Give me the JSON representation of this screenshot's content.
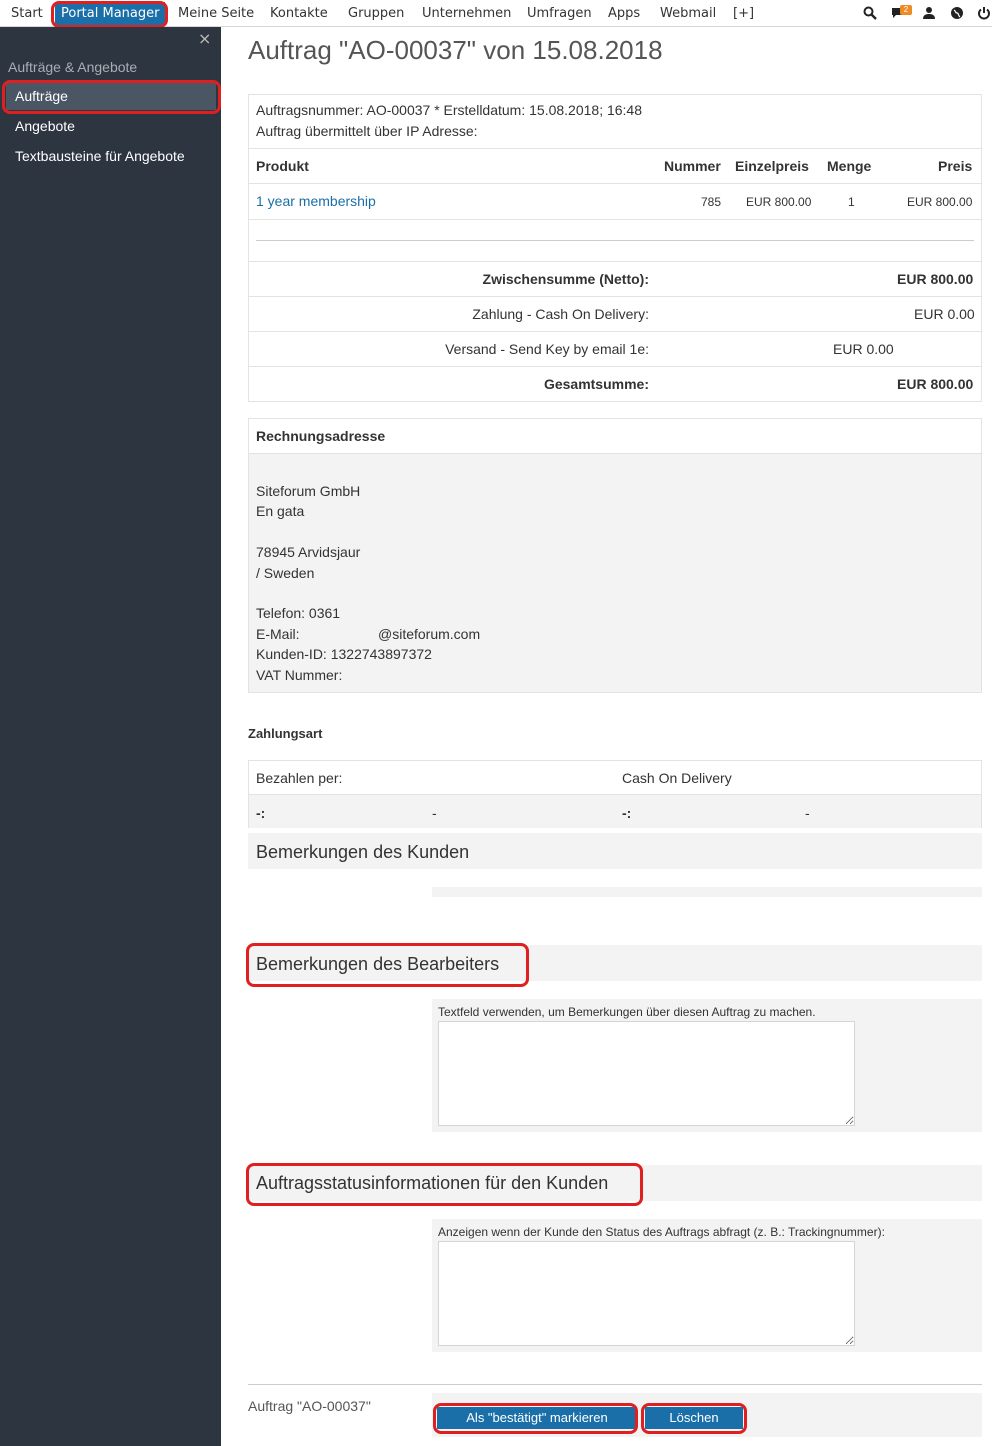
{
  "topnav": {
    "items": [
      "Start",
      "Portal Manager",
      "Meine Seite",
      "Kontakte",
      "Gruppen",
      "Unternehmen",
      "Umfragen",
      "Apps",
      "Webmail",
      "[+]"
    ],
    "badge_count": "2",
    "icons": [
      "search-icon",
      "chat-icon",
      "user-icon",
      "globe-icon",
      "power-icon"
    ]
  },
  "sidebar": {
    "close": "×",
    "section": "Aufträge & Angebote",
    "items": [
      "Aufträge",
      "Angebote",
      "Textbausteine für Angebote"
    ]
  },
  "page": {
    "title": "Auftrag \"AO-00037\" von 15.08.2018"
  },
  "order": {
    "info_line1": "Auftragsnummer: AO-00037 * Erstelldatum: 15.08.2018; 16:48",
    "info_line2": "Auftrag übermittelt über IP Adresse:",
    "columns": {
      "product": "Produkt",
      "number": "Nummer",
      "unit_price": "Einzelpreis",
      "qty": "Menge",
      "price": "Preis"
    },
    "item": {
      "product": "1 year membership",
      "number": "785",
      "unit_price": "EUR 800.00",
      "qty": "1",
      "price": "EUR 800.00"
    },
    "subtotal_label": "Zwischensumme (Netto):",
    "subtotal_value": "EUR 800.00",
    "payment_label": "Zahlung - Cash On Delivery:",
    "payment_value": "EUR 0.00",
    "shipping_label": "Versand - Send Key by email 1e:",
    "shipping_value": "EUR 0.00",
    "total_label": "Gesamtsumme:",
    "total_value": "EUR 800.00"
  },
  "billing": {
    "heading": "Rechnungsadresse",
    "company": "Siteforum GmbH",
    "street": "En gata",
    "city": "78945 Arvidsjaur",
    "country": "/ Sweden",
    "phone": "Telefon: 0361",
    "email_label": "E-Mail:",
    "email_value": "@siteforum.com",
    "customer_id": "Kunden-ID: 1322743897372",
    "vat": "VAT Nummer:"
  },
  "payment": {
    "heading": "Zahlungsart",
    "pay_by_label": "Bezahlen per:",
    "pay_by_value": "Cash On Delivery",
    "r2c1": "-:",
    "r2c2": "-",
    "r2c3": "-:",
    "r2c4": "-"
  },
  "customer_notes": {
    "heading": "Bemerkungen des Kunden"
  },
  "editor_notes": {
    "heading": "Bemerkungen des Bearbeiters",
    "hint": "Textfeld verwenden, um Bemerkungen über diesen Auftrag zu machen."
  },
  "status_info": {
    "heading": "Auftragsstatusinformationen für den Kunden",
    "hint": "Anzeigen wenn der Kunde den Status des Auftrags abfragt (z. B.: Trackingnummer):"
  },
  "footer": {
    "label": "Auftrag \"AO-00037\"",
    "confirm_button": "Als \"bestätigt\" markieren",
    "delete_button": "Löschen"
  },
  "colors": {
    "accent": "#1a6fa8",
    "sidebar": "#2d3540",
    "highlight": "#e02020",
    "badge": "#f08a24"
  }
}
